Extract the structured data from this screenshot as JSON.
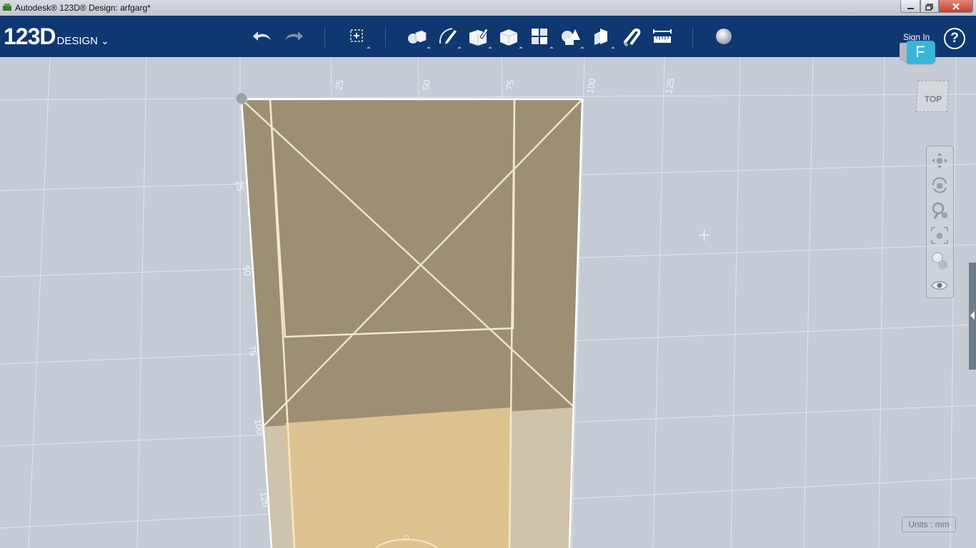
{
  "window": {
    "title": "Autodesk® 123D® Design: arfgarg*"
  },
  "toolbar": {
    "logo_number": "123D",
    "logo_label": "DESIGN",
    "tools": [
      {
        "name": "undo-icon"
      },
      {
        "name": "redo-icon"
      },
      {
        "name": "transform-icon"
      },
      {
        "name": "primitives-icon"
      },
      {
        "name": "sketch-icon"
      },
      {
        "name": "construct-icon"
      },
      {
        "name": "modify-icon"
      },
      {
        "name": "pattern-icon"
      },
      {
        "name": "grouping-icon"
      },
      {
        "name": "combine-icon"
      },
      {
        "name": "snap-icon"
      },
      {
        "name": "measure-icon"
      },
      {
        "name": "material-icon"
      }
    ],
    "sign_in": "Sign In",
    "help": "?",
    "badge": "F"
  },
  "viewport": {
    "view_cube_label": "TOP",
    "top_ruler": [
      "25",
      "50",
      "75",
      "100",
      "125"
    ],
    "left_ruler": [
      "25",
      "50",
      "75",
      "100",
      "125"
    ],
    "units": "Units : mm"
  },
  "colors": {
    "toolbar_bg": "#0f3770",
    "viewport_bg": "#c5ccd6",
    "solid_dark": "#9c8f74",
    "solid_light": "#dcc28e",
    "badge": "#38b5d8"
  },
  "nav_tools": [
    "pan-icon",
    "orbit-icon",
    "zoom-icon",
    "fit-icon",
    "view-style-icon",
    "visibility-icon"
  ]
}
